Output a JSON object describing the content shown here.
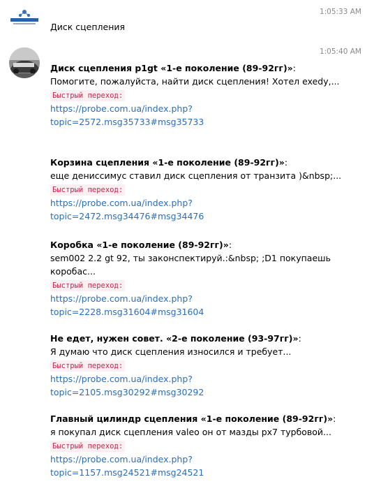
{
  "messages": [
    {
      "time": "1:05:33 AM",
      "avatar_icon": "forum-logo-icon",
      "text": "Диск сцепления"
    },
    {
      "time": "1:05:40 AM",
      "avatar_icon": "car-photo-avatar"
    }
  ],
  "results": [
    {
      "title": "Диск сцепления p1gt «1-е поколение (89-92гг)»",
      "colon": ":",
      "snippet": "Помогите, пожалуйста, найти диск сцепления! Хотел exedy,...",
      "tag": "Быстрый переход:",
      "link_line1": "https://probe.com.ua/index.php?",
      "link_line2": "topic=2572.msg35733#msg35733"
    },
    {
      "title": "Корзина сцепления «1-е поколение (89-92гг)»",
      "colon": ":",
      "snippet": "еще дениссимус ставил диск сцепления от транзита )&nbsp;...",
      "tag": "Быстрый переход:",
      "link_line1": "https://probe.com.ua/index.php?",
      "link_line2": "topic=2472.msg34476#msg34476"
    },
    {
      "title": "Коробка «1-е поколение (89-92гг)»",
      "colon": ":",
      "snippet": "sem002 2.2 gt 92, ты законспектируй.:&nbsp; ;D1 покупаешь коробас...",
      "tag": "Быстрый переход:",
      "link_line1": "https://probe.com.ua/index.php?",
      "link_line2": "topic=2228.msg31604#msg31604"
    },
    {
      "title": "Не едет, нужен совет. «2-е поколение (93-97гг)»",
      "colon": ":",
      "snippet": "Я думаю что диск сцепления износился и требует...",
      "tag": "Быстрый переход:",
      "link_line1": "https://probe.com.ua/index.php?",
      "link_line2": "topic=2105.msg30292#msg30292"
    },
    {
      "title": "Главный цилиндр сцепления «1-е поколение (89-92гг)»",
      "colon": ":",
      "snippet": "я покупал диск сцепления valeo он от мазды рх7 турбовой...",
      "tag": "Быстрый переход:",
      "link_line1": "https://probe.com.ua/index.php?",
      "link_line2": "topic=1157.msg24521#msg24521"
    }
  ]
}
